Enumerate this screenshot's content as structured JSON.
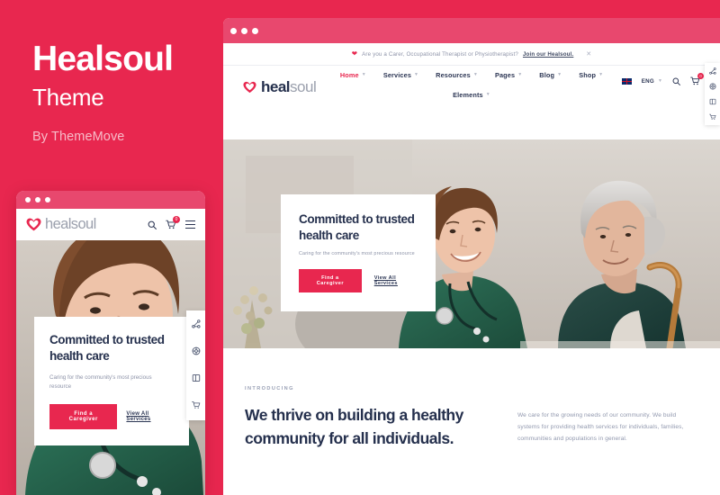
{
  "brand": {
    "title": "Healsoul",
    "subtitle": "Theme",
    "author": "By ThemeMove"
  },
  "colors": {
    "accent": "#E8274F",
    "chrome": "#E8486E",
    "heading": "#25304D",
    "muted": "#9198AE"
  },
  "desktop": {
    "notice": {
      "heart_icon": "heart-icon",
      "text": "Are you a Carer, Occupational Therapist or Physiotherapist?",
      "link": "Join our Healsoul.",
      "close_icon": "close-icon"
    },
    "logo": {
      "primary": "heal",
      "secondary": "soul",
      "icon": "heart-logo-icon"
    },
    "nav": [
      {
        "label": "Home",
        "active": true
      },
      {
        "label": "Services",
        "active": false
      },
      {
        "label": "Resources",
        "active": false
      },
      {
        "label": "Pages",
        "active": false
      },
      {
        "label": "Blog",
        "active": false
      },
      {
        "label": "Shop",
        "active": false
      }
    ],
    "nav_second": [
      {
        "label": "Elements",
        "active": false
      }
    ],
    "header_right": {
      "flag_icon": "uk-flag-icon",
      "language": "ENG",
      "search_icon": "search-icon",
      "cart_icon": "cart-icon",
      "cart_count": "0"
    },
    "hero": {
      "heading": "Committed to trusted health care",
      "paragraph": "Caring for the community's most precious resource",
      "primary_button": "Find a Caregiver",
      "secondary_button": "View All Services"
    },
    "side_tools": [
      {
        "icon": "share-icon"
      },
      {
        "icon": "globe-settings-icon"
      },
      {
        "icon": "layout-icon"
      },
      {
        "icon": "cart-icon"
      }
    ],
    "intro": {
      "eyebrow": "INTRODUCING",
      "heading": "We thrive on building a healthy community for all individuals.",
      "paragraph": "We care for the growing needs of our community. We build systems for providing health services for individuals, families, communities and populations in general."
    }
  },
  "mobile": {
    "logo": {
      "primary": "heal",
      "secondary": "soul",
      "icon": "heart-logo-icon"
    },
    "header_icons": {
      "search_icon": "search-icon",
      "cart_icon": "cart-icon",
      "cart_count": "0",
      "menu_icon": "hamburger-menu-icon"
    },
    "hero": {
      "heading": "Committed to trusted health care",
      "paragraph": "Caring for the community's most precious resource",
      "primary_button": "Find a Caregiver",
      "secondary_button": "View All Services"
    },
    "side_tools": [
      {
        "icon": "share-icon"
      },
      {
        "icon": "globe-settings-icon"
      },
      {
        "icon": "layout-icon"
      },
      {
        "icon": "cart-icon"
      }
    ]
  }
}
